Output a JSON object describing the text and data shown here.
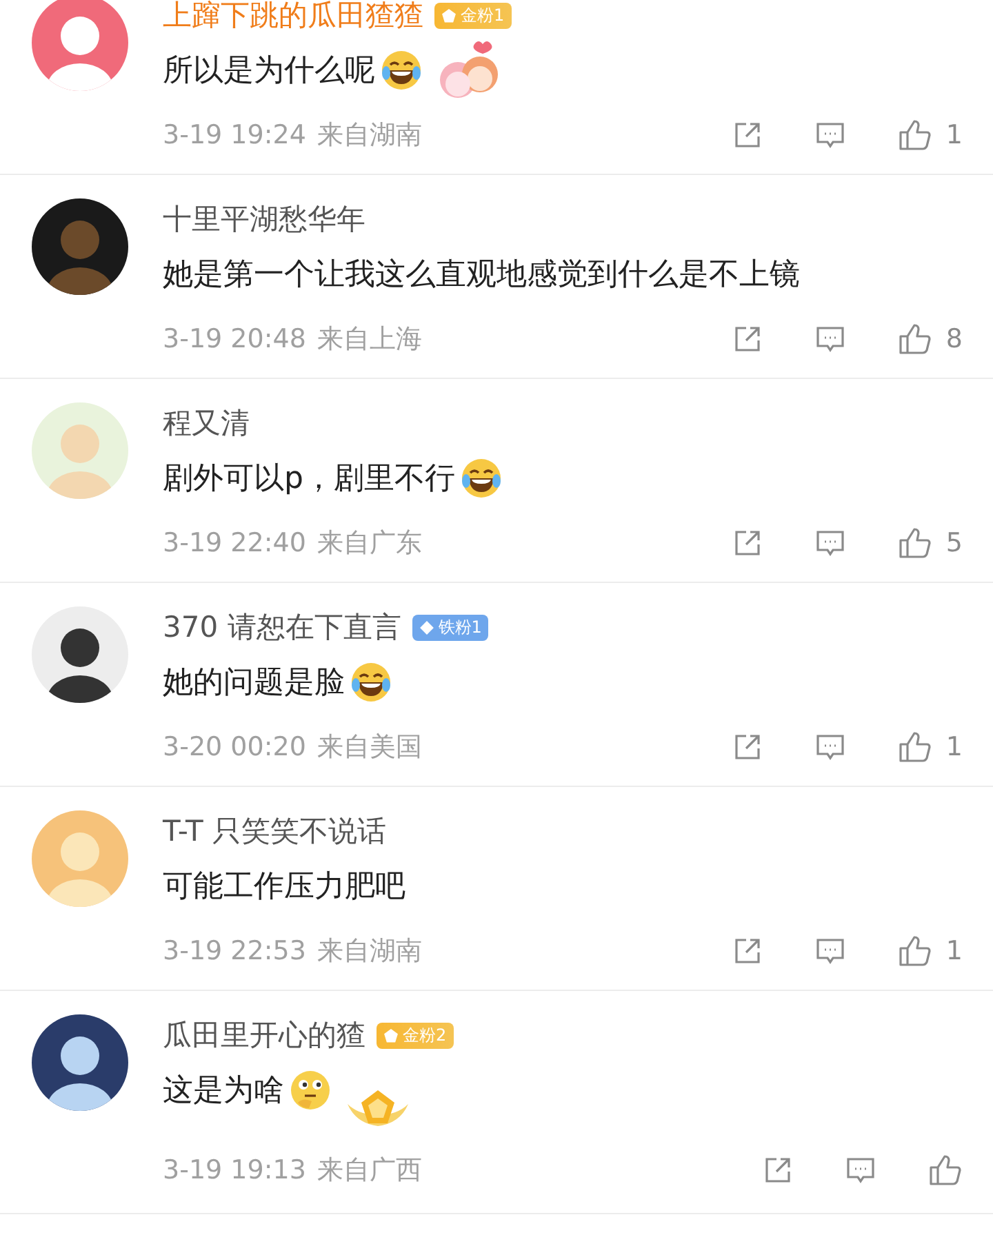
{
  "comments": [
    {
      "name": "上蹿下跳的瓜田猹猹",
      "badge": {
        "kind": "gold",
        "text": "金粉1"
      },
      "text": "所以是为什么呢",
      "emoji": {
        "kind": "laugh"
      },
      "sticker": {
        "kind": "couple"
      },
      "time": "3-19 19:24",
      "location": "来自湖南",
      "likes": "1"
    },
    {
      "name": "十里平湖愁华年",
      "text": "她是第一个让我这么直观地感觉到什么是不上镜",
      "time": "3-19 20:48",
      "location": "来自上海",
      "likes": "8"
    },
    {
      "name": "程又清",
      "text": "剧外可以p，剧里不行",
      "emoji": {
        "kind": "laugh"
      },
      "time": "3-19 22:40",
      "location": "来自广东",
      "likes": "5"
    },
    {
      "name": "370 请恕在下直言",
      "badge": {
        "kind": "iron",
        "text": "铁粉1"
      },
      "text": "她的问题是脸",
      "emoji": {
        "kind": "laugh"
      },
      "time": "3-20 00:20",
      "location": "来自美国",
      "likes": "1"
    },
    {
      "name": "T-T 只笑笑不说话",
      "text": "可能工作压力肥吧",
      "time": "3-19 22:53",
      "location": "来自湖南",
      "likes": "1"
    },
    {
      "name": "瓜田里开心的猹",
      "badge": {
        "kind": "gold",
        "text": "金粉2"
      },
      "text": "这是为啥",
      "emoji": {
        "kind": "hmm"
      },
      "sticker": {
        "kind": "medal"
      },
      "time": "3-19 19:13",
      "location": "来自广西"
    }
  ]
}
